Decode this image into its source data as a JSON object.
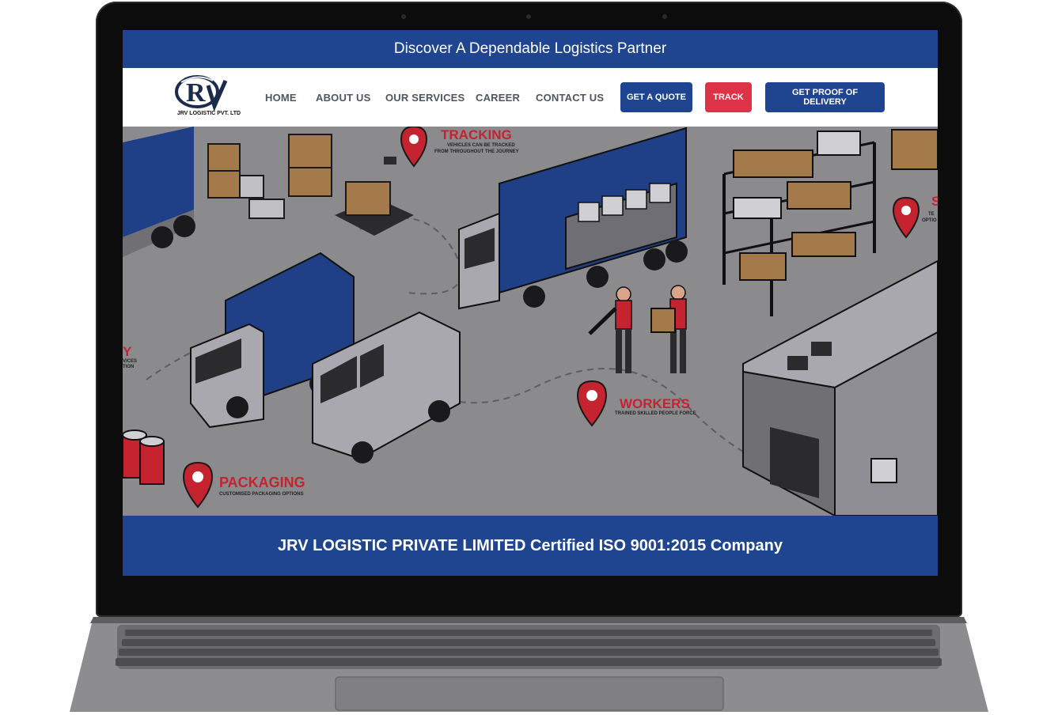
{
  "top_banner": {
    "text": "Discover A Dependable Logistics Partner"
  },
  "logo": {
    "caption": "JRV LOGISTIC PVT. LTD"
  },
  "nav": {
    "items": [
      {
        "label": "HOME"
      },
      {
        "label": "ABOUT US"
      },
      {
        "label": "OUR SERVICES"
      },
      {
        "label": "CAREER"
      },
      {
        "label": "CONTACT US"
      }
    ]
  },
  "buttons": {
    "quote": "GET A QUOTE",
    "track": "TRACK",
    "proof": "GET PROOF OF DELIVERY"
  },
  "hero": {
    "tracking": {
      "title": "TRACKING",
      "sub1": "VEHICLES CAN BE TRACKED",
      "sub2": "FROM THROUGHOUT THE JOURNEY"
    },
    "workers": {
      "title": "WORKERS",
      "sub": "TRAINED SKILLED PEOPLE FORCE"
    },
    "packaging": {
      "title": "PACKAGING",
      "sub": "CUSTOMISED PACKAGING OPTIONS"
    },
    "left_fragment": {
      "title": "Y",
      "sub1": "VICES",
      "sub2": "TION"
    },
    "right_fragment": {
      "title": "S",
      "sub1": "TE",
      "sub2": "OPTIO"
    }
  },
  "certification": {
    "text": "JRV LOGISTIC PRIVATE LIMITED Certified ISO 9001:2015 Company"
  },
  "colors": {
    "brand_blue": "#1f4590",
    "accent_red": "#dd3346",
    "hero_gray": "#8a8a8c"
  }
}
